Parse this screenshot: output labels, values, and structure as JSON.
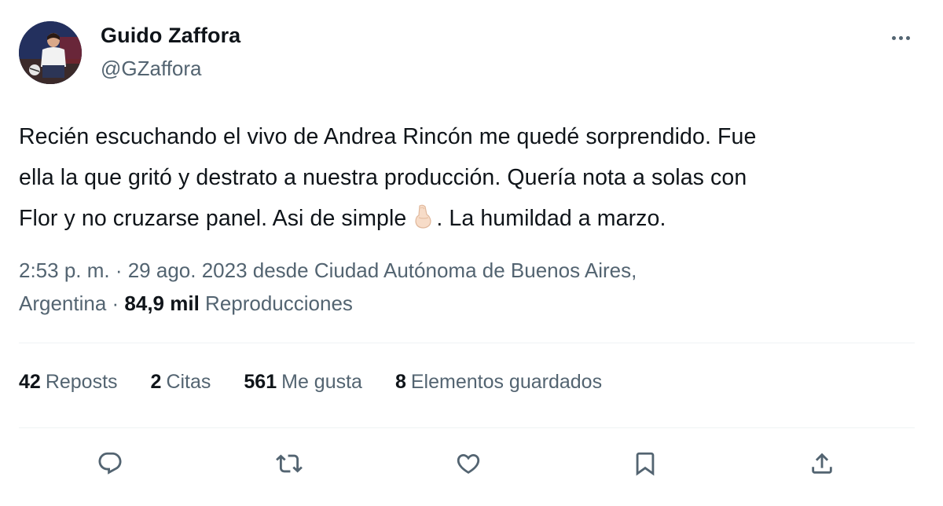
{
  "author": {
    "display_name": "Guido Zaffora",
    "handle": "@GZaffora"
  },
  "tweet": {
    "lines": [
      "Recién escuchando el vivo de Andrea Rincón me quedé sorprendido. Fue",
      "ella la que gritó y destrato a nuestra producción. Quería nota a solas con"
    ],
    "line3_before_emoji": "Flor y no cruzarse  panel. Asi de simple",
    "line3_after_emoji": ". La humildad a marzo."
  },
  "meta": {
    "line1": "2:53 p. m. · 29 ago. 2023 desde Ciudad Autónoma de Buenos Aires,",
    "line2_prefix": "Argentina · ",
    "views_count": "84,9 mil",
    "views_label": " Reproducciones"
  },
  "stats": {
    "reposts": {
      "count": "42",
      "label": "Reposts"
    },
    "quotes": {
      "count": "2",
      "label": "Citas"
    },
    "likes": {
      "count": "561",
      "label": "Me gusta"
    },
    "bookmarks": {
      "count": "8",
      "label": "Elementos guardados"
    }
  },
  "colors": {
    "text_primary": "#0f1419",
    "text_secondary": "#536471",
    "divider": "#eff3f4"
  },
  "icons": {
    "more": "more-horizontal-icon",
    "reply": "reply-icon",
    "repost": "repost-icon",
    "like": "heart-icon",
    "bookmark": "bookmark-icon",
    "share": "share-icon",
    "emoji": "pinched-fingers-emoji"
  }
}
